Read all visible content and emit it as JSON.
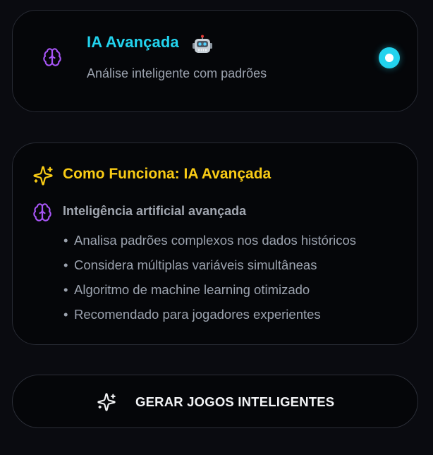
{
  "option": {
    "title": "IA Avançada",
    "description": "Análise inteligente com padrões",
    "selected": true,
    "icon": "brain-icon",
    "badge_icon": "robot-icon",
    "accent_color": "#22d3ee"
  },
  "info": {
    "title": "Como Funciona: IA Avançada",
    "subtitle": "Inteligência artificial avançada",
    "title_color": "#facc15",
    "title_icon": "sparkles-icon",
    "subtitle_icon": "brain-icon",
    "features": [
      "Analisa padrões complexos nos dados históricos",
      "Considera múltiplas variáveis simultâneas",
      "Algoritmo de machine learning otimizado",
      "Recomendado para jogadores experientes"
    ]
  },
  "action": {
    "label": "GERAR JOGOS INTELIGENTES",
    "icon": "sparkles-icon"
  }
}
